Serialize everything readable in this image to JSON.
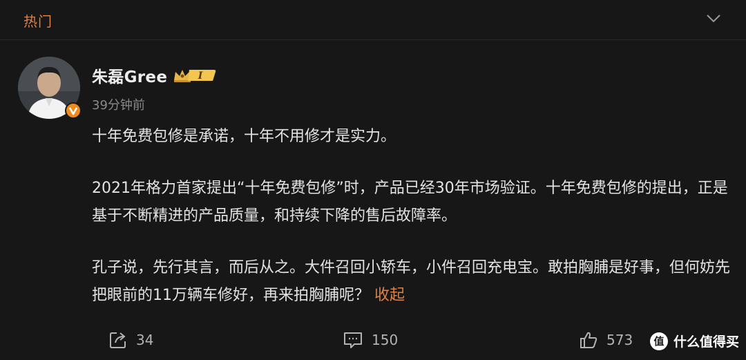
{
  "section": {
    "title": "热门",
    "collapse_icon": "chevron-down-icon"
  },
  "post": {
    "author": {
      "name": "朱磊Gree",
      "member_badge": "I",
      "avatar_icon": "user-avatar",
      "verified_icon": "verified-v-icon"
    },
    "timestamp": "39分钟前",
    "paragraphs": [
      "十年免费包修是承诺，十年不用修才是实力。",
      "2021年格力首家提出“十年免费包修”时，产品已经30年市场验证。十年免费包修的提出，正是基于不断精进的产品质量，和持续下降的售后故障率。",
      "孔子说，先行其言，而后从之。大件召回小轿车，小件召回充电宝。敢拍胸脯是好事，但何妨先把眼前的11万辆车修好，再来拍胸脯呢？"
    ],
    "collapse_label": "收起"
  },
  "actions": {
    "repost": {
      "icon": "share-icon",
      "count": "34"
    },
    "comment": {
      "icon": "comment-icon",
      "count": "150"
    },
    "like": {
      "icon": "thumbs-up-icon",
      "count": "573"
    }
  },
  "watermark": {
    "logo": "值",
    "text": "什么值得买"
  },
  "colors": {
    "background": "#171717",
    "accent": "#d9824a",
    "text": "#e3e3e3",
    "muted": "#8a8a8a"
  }
}
